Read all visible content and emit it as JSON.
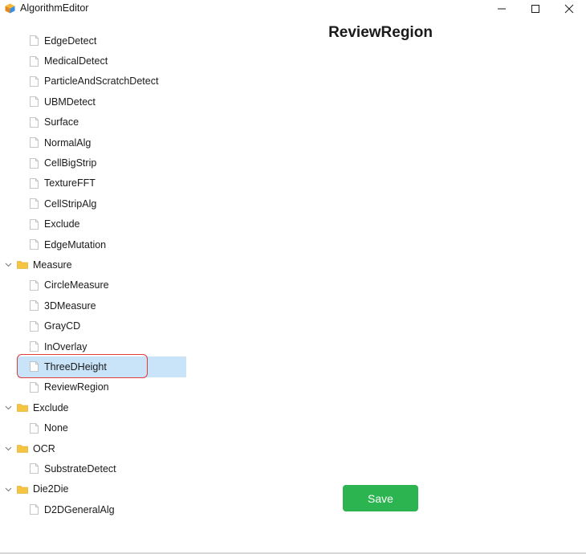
{
  "window": {
    "title": "AlgorithmEditor",
    "minimize_icon": "minimize-icon",
    "maximize_icon": "maximize-icon",
    "close_icon": "close-icon"
  },
  "tree": {
    "rows": [
      {
        "type": "leaf",
        "label": "EdgeDetect"
      },
      {
        "type": "leaf",
        "label": "MedicalDetect"
      },
      {
        "type": "leaf",
        "label": "ParticleAndScratchDetect"
      },
      {
        "type": "leaf",
        "label": "UBMDetect"
      },
      {
        "type": "leaf",
        "label": "Surface"
      },
      {
        "type": "leaf",
        "label": "NormalAlg"
      },
      {
        "type": "leaf",
        "label": "CellBigStrip"
      },
      {
        "type": "leaf",
        "label": "TextureFFT"
      },
      {
        "type": "leaf",
        "label": "CellStripAlg"
      },
      {
        "type": "leaf",
        "label": "Exclude"
      },
      {
        "type": "leaf",
        "label": "EdgeMutation"
      },
      {
        "type": "folder",
        "label": "Measure"
      },
      {
        "type": "leaf",
        "label": "CircleMeasure"
      },
      {
        "type": "leaf",
        "label": "3DMeasure"
      },
      {
        "type": "leaf",
        "label": "GrayCD"
      },
      {
        "type": "leaf",
        "label": "InOverlay"
      },
      {
        "type": "leaf",
        "label": "ThreeDHeight",
        "selected": true
      },
      {
        "type": "leaf",
        "label": "ReviewRegion"
      },
      {
        "type": "folder",
        "label": "Exclude"
      },
      {
        "type": "leaf",
        "label": "None"
      },
      {
        "type": "folder",
        "label": "OCR"
      },
      {
        "type": "leaf",
        "label": "SubstrateDetect"
      },
      {
        "type": "folder",
        "label": "Die2Die"
      },
      {
        "type": "leaf",
        "label": "D2DGeneralAlg"
      }
    ]
  },
  "main": {
    "title": "ReviewRegion",
    "save_label": "Save"
  },
  "colors": {
    "selection_bg": "#c9e4f8",
    "selection_outline": "#e23b3b",
    "save_button": "#2bb44f",
    "folder": "#f5c542"
  }
}
